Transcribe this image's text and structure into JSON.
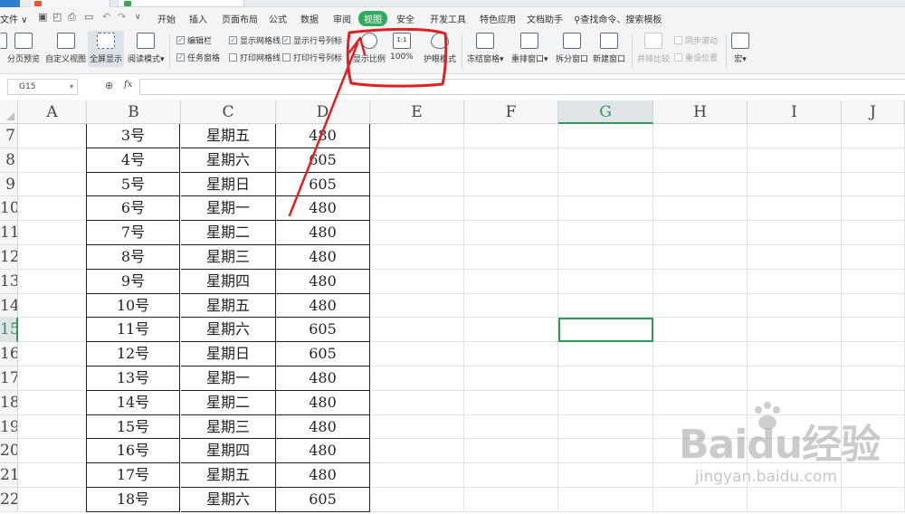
{
  "menubar": {
    "file": "文件",
    "items": [
      "开始",
      "插入",
      "页面布局",
      "公式",
      "数据",
      "审阅",
      "视图",
      "安全",
      "开发工具",
      "特色应用",
      "文档助手"
    ],
    "active": "视图",
    "search": "查找命令、搜索模板"
  },
  "ribbon": {
    "page_break_preview": "分页预览",
    "custom_view": "自定义视图",
    "full_screen": "全屏显示",
    "reading_mode": "阅读模式",
    "check_edit_bar": "编辑栏",
    "check_task_pane": "任务窗格",
    "check_show_gridlines": "显示网格线",
    "check_print_gridlines": "打印网格线",
    "check_show_headings": "显示行号列标",
    "check_print_headings": "打印行号列标",
    "zoom": "显示比例",
    "zoom_100": "100%",
    "eye_mode": "护眼模式",
    "freeze_panes": "冻结窗格",
    "arrange_windows": "重排窗口",
    "split_window": "拆分窗口",
    "new_window": "新建窗口",
    "side_by_side": "并排比较",
    "sync_scroll": "同步滚动",
    "reset_position": "重设位置",
    "macro": "宏"
  },
  "formula_bar": {
    "name_box": "G15",
    "fx": "fx",
    "content": ""
  },
  "columns": [
    "A",
    "B",
    "C",
    "D",
    "E",
    "F",
    "G",
    "H",
    "I",
    "J"
  ],
  "selected_column": "G",
  "selected_row": "15",
  "rows": [
    {
      "num": "7",
      "b": "3号",
      "c": "星期五",
      "d": "480"
    },
    {
      "num": "8",
      "b": "4号",
      "c": "星期六",
      "d": "605"
    },
    {
      "num": "9",
      "b": "5号",
      "c": "星期日",
      "d": "605"
    },
    {
      "num": "10",
      "b": "6号",
      "c": "星期一",
      "d": "480"
    },
    {
      "num": "11",
      "b": "7号",
      "c": "星期二",
      "d": "480"
    },
    {
      "num": "12",
      "b": "8号",
      "c": "星期三",
      "d": "480"
    },
    {
      "num": "13",
      "b": "9号",
      "c": "星期四",
      "d": "480"
    },
    {
      "num": "14",
      "b": "10号",
      "c": "星期五",
      "d": "480"
    },
    {
      "num": "15",
      "b": "11号",
      "c": "星期六",
      "d": "605"
    },
    {
      "num": "16",
      "b": "12号",
      "c": "星期日",
      "d": "605"
    },
    {
      "num": "17",
      "b": "13号",
      "c": "星期一",
      "d": "480"
    },
    {
      "num": "18",
      "b": "14号",
      "c": "星期二",
      "d": "480"
    },
    {
      "num": "19",
      "b": "15号",
      "c": "星期三",
      "d": "480"
    },
    {
      "num": "20",
      "b": "16号",
      "c": "星期四",
      "d": "480"
    },
    {
      "num": "21",
      "b": "17号",
      "c": "星期五",
      "d": "480"
    },
    {
      "num": "22",
      "b": "18号",
      "c": "星期六",
      "d": "605"
    }
  ],
  "watermark": {
    "brand": "Baidu经验",
    "url": "jingyan.baidu.com"
  },
  "colors": {
    "accent_green": "#2eab5e",
    "annotation_red": "#e02020"
  }
}
